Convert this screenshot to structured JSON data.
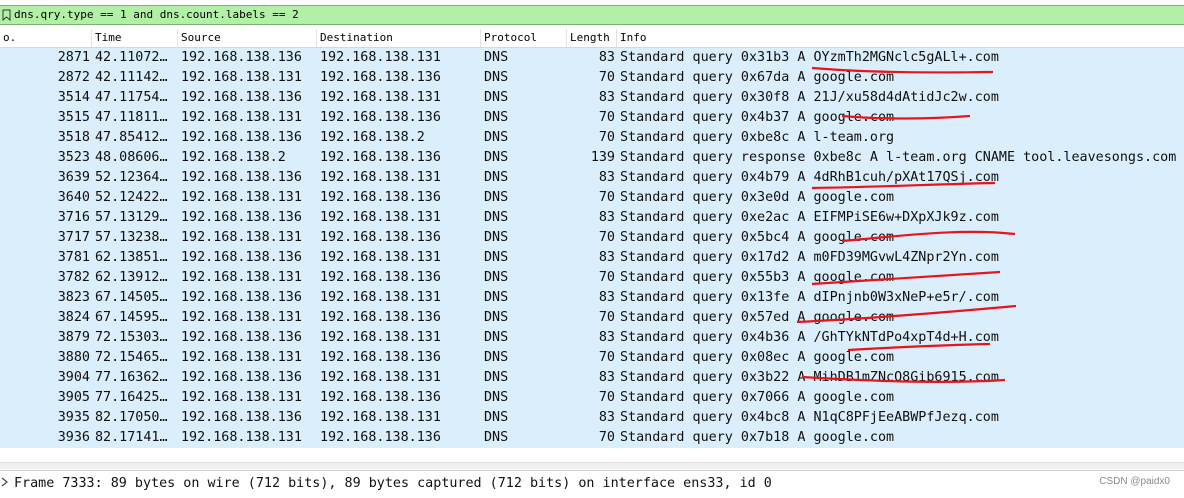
{
  "filter": {
    "text": "dns.qry.type == 1 and dns.count.labels == 2"
  },
  "columns": {
    "no": "o.",
    "time": "Time",
    "source": "Source",
    "destination": "Destination",
    "protocol": "Protocol",
    "length": "Length",
    "info": "Info"
  },
  "packets": [
    {
      "no": "2871",
      "time": "42.11072…",
      "src": "192.168.138.136",
      "dst": "192.168.138.131",
      "proto": "DNS",
      "len": "83",
      "info": "Standard query 0x31b3 A OYzmTh2MGNclc5gALl+.com"
    },
    {
      "no": "2872",
      "time": "42.11142…",
      "src": "192.168.138.131",
      "dst": "192.168.138.136",
      "proto": "DNS",
      "len": "70",
      "info": "Standard query 0x67da A google.com"
    },
    {
      "no": "3514",
      "time": "47.11754…",
      "src": "192.168.138.136",
      "dst": "192.168.138.131",
      "proto": "DNS",
      "len": "83",
      "info": "Standard query 0x30f8 A 21J/xu58d4dAtidJc2w.com"
    },
    {
      "no": "3515",
      "time": "47.11811…",
      "src": "192.168.138.131",
      "dst": "192.168.138.136",
      "proto": "DNS",
      "len": "70",
      "info": "Standard query 0x4b37 A google.com"
    },
    {
      "no": "3518",
      "time": "47.85412…",
      "src": "192.168.138.136",
      "dst": "192.168.138.2",
      "proto": "DNS",
      "len": "70",
      "info": "Standard query 0xbe8c A l-team.org"
    },
    {
      "no": "3523",
      "time": "48.08606…",
      "src": "192.168.138.2",
      "dst": "192.168.138.136",
      "proto": "DNS",
      "len": "139",
      "info": "Standard query response 0xbe8c A l-team.org CNAME tool.leavesongs.com C"
    },
    {
      "no": "3639",
      "time": "52.12364…",
      "src": "192.168.138.136",
      "dst": "192.168.138.131",
      "proto": "DNS",
      "len": "83",
      "info": "Standard query 0x4b79 A 4dRhB1cuh/pXAt17QSj.com"
    },
    {
      "no": "3640",
      "time": "52.12422…",
      "src": "192.168.138.131",
      "dst": "192.168.138.136",
      "proto": "DNS",
      "len": "70",
      "info": "Standard query 0x3e0d A google.com"
    },
    {
      "no": "3716",
      "time": "57.13129…",
      "src": "192.168.138.136",
      "dst": "192.168.138.131",
      "proto": "DNS",
      "len": "83",
      "info": "Standard query 0xe2ac A EIFMPiSE6w+DXpXJk9z.com"
    },
    {
      "no": "3717",
      "time": "57.13238…",
      "src": "192.168.138.131",
      "dst": "192.168.138.136",
      "proto": "DNS",
      "len": "70",
      "info": "Standard query 0x5bc4 A google.com"
    },
    {
      "no": "3781",
      "time": "62.13851…",
      "src": "192.168.138.136",
      "dst": "192.168.138.131",
      "proto": "DNS",
      "len": "83",
      "info": "Standard query 0x17d2 A m0FD39MGvwL4ZNpr2Yn.com"
    },
    {
      "no": "3782",
      "time": "62.13912…",
      "src": "192.168.138.131",
      "dst": "192.168.138.136",
      "proto": "DNS",
      "len": "70",
      "info": "Standard query 0x55b3 A google.com"
    },
    {
      "no": "3823",
      "time": "67.14505…",
      "src": "192.168.138.136",
      "dst": "192.168.138.131",
      "proto": "DNS",
      "len": "83",
      "info": "Standard query 0x13fe A dIPnjnb0W3xNeP+e5r/.com"
    },
    {
      "no": "3824",
      "time": "67.14595…",
      "src": "192.168.138.131",
      "dst": "192.168.138.136",
      "proto": "DNS",
      "len": "70",
      "info": "Standard query 0x57ed A google.com"
    },
    {
      "no": "3879",
      "time": "72.15303…",
      "src": "192.168.138.136",
      "dst": "192.168.138.131",
      "proto": "DNS",
      "len": "83",
      "info": "Standard query 0x4b36 A /GhTYkNTdPo4xpT4d+H.com"
    },
    {
      "no": "3880",
      "time": "72.15465…",
      "src": "192.168.138.131",
      "dst": "192.168.138.136",
      "proto": "DNS",
      "len": "70",
      "info": "Standard query 0x08ec A google.com"
    },
    {
      "no": "3904",
      "time": "77.16362…",
      "src": "192.168.138.136",
      "dst": "192.168.138.131",
      "proto": "DNS",
      "len": "83",
      "info": "Standard query 0x3b22 A MihDB1mZNcQ8Gib6915.com"
    },
    {
      "no": "3905",
      "time": "77.16425…",
      "src": "192.168.138.131",
      "dst": "192.168.138.136",
      "proto": "DNS",
      "len": "70",
      "info": "Standard query 0x7066 A google.com"
    },
    {
      "no": "3935",
      "time": "82.17050…",
      "src": "192.168.138.136",
      "dst": "192.168.138.131",
      "proto": "DNS",
      "len": "83",
      "info": "Standard query 0x4bc8 A N1qC8PFjEeABWPfJezq.com"
    },
    {
      "no": "3936",
      "time": "82.17141…",
      "src": "192.168.138.131",
      "dst": "192.168.138.136",
      "proto": "DNS",
      "len": "70",
      "info": "Standard query 0x7b18 A google.com"
    }
  ],
  "detail": {
    "frame_text": "Frame 7333: 89 bytes on wire (712 bits), 89 bytes captured (712 bits) on interface ens33, id 0"
  },
  "watermark": "CSDN @paidx0",
  "colors": {
    "row_bg": "#dbeefb",
    "filter_bg": "#b3f0a7",
    "annotation": "#e8141c"
  }
}
